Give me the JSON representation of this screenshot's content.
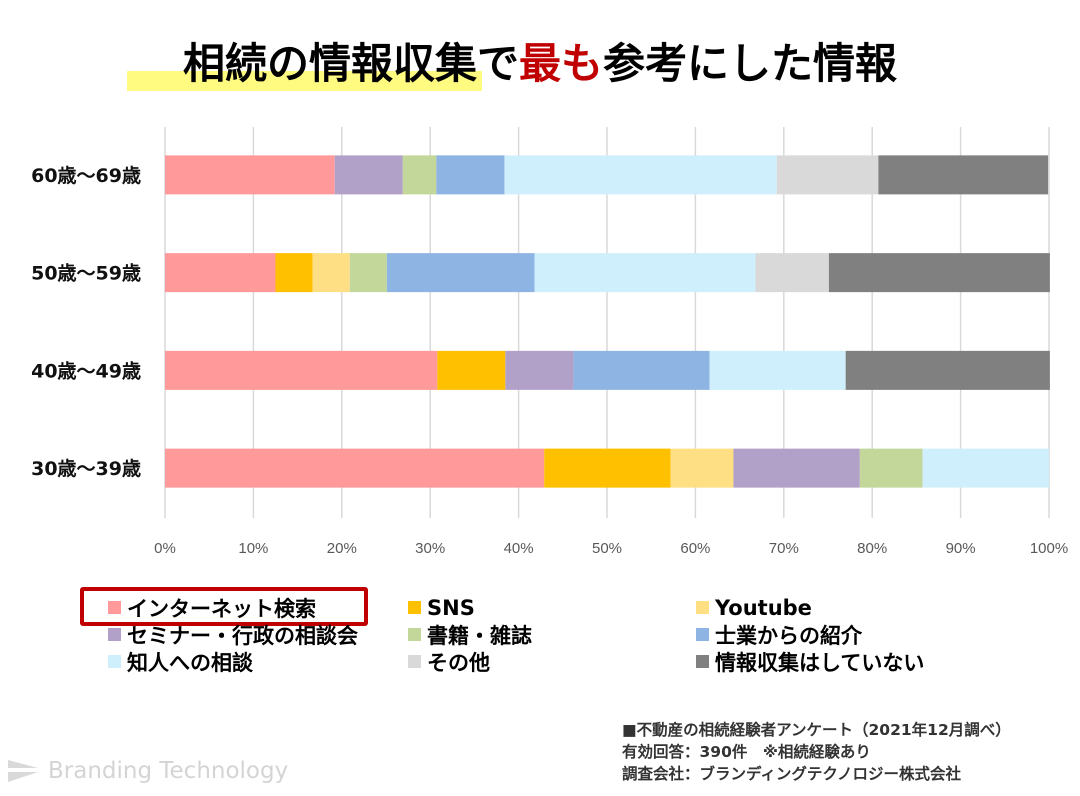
{
  "title": {
    "part1": "相続の情報収集で",
    "accent": "最も",
    "part2": "参考にした情報"
  },
  "chart_data": {
    "type": "bar",
    "orientation": "horizontal",
    "stacked": "100%",
    "title": "相続の情報収集で最も参考にした情報",
    "xlabel": "",
    "ylabel": "",
    "xlim": [
      0,
      100
    ],
    "x_ticks": [
      "0%",
      "10%",
      "20%",
      "30%",
      "40%",
      "50%",
      "60%",
      "70%",
      "80%",
      "90%",
      "100%"
    ],
    "grid": "vertical",
    "legend_position": "bottom",
    "categories": [
      "60歳～69歳",
      "50歳～59歳",
      "40歳～49歳",
      "30歳～39歳"
    ],
    "series": [
      {
        "name": "インターネット検索",
        "color": "#FF999A",
        "values": [
          19.2,
          12.5,
          30.8,
          42.9
        ]
      },
      {
        "name": "SNS",
        "color": "#FFC000",
        "values": [
          0,
          4.2,
          7.7,
          14.3
        ]
      },
      {
        "name": "Youtube",
        "color": "#FFDF84",
        "values": [
          0,
          4.2,
          0,
          7.1
        ]
      },
      {
        "name": "セミナー・行政の相談会",
        "color": "#B1A0C7",
        "values": [
          7.7,
          0,
          7.7,
          14.3
        ]
      },
      {
        "name": "書籍・雑誌",
        "color": "#C4D79B",
        "values": [
          3.8,
          4.2,
          0,
          7.1
        ]
      },
      {
        "name": "士業からの紹介",
        "color": "#8EB4E3",
        "values": [
          7.7,
          16.7,
          15.4,
          0
        ]
      },
      {
        "name": "知人への相談",
        "color": "#CFEFFC",
        "values": [
          30.8,
          25.0,
          15.4,
          14.3
        ]
      },
      {
        "name": "その他",
        "color": "#D9D9D9",
        "values": [
          11.5,
          8.3,
          0,
          0
        ]
      },
      {
        "name": "情報収集はしていない",
        "color": "#808080",
        "values": [
          19.2,
          25.0,
          23.1,
          0
        ]
      }
    ],
    "highlighted_legend_entry": "インターネット検索"
  },
  "source": {
    "line1": "■不動産の相続経験者アンケート（2021年12月調べ）",
    "line2": "有効回答：390件　※相続経験あり",
    "line3": "調査会社：ブランディングテクノロジー株式会社"
  },
  "brand": {
    "name": "Branding Technology",
    "icon": "arrow-logo-icon"
  },
  "colors": {
    "accent_red": "#C00000",
    "title_highlight": "#FFFA80"
  }
}
